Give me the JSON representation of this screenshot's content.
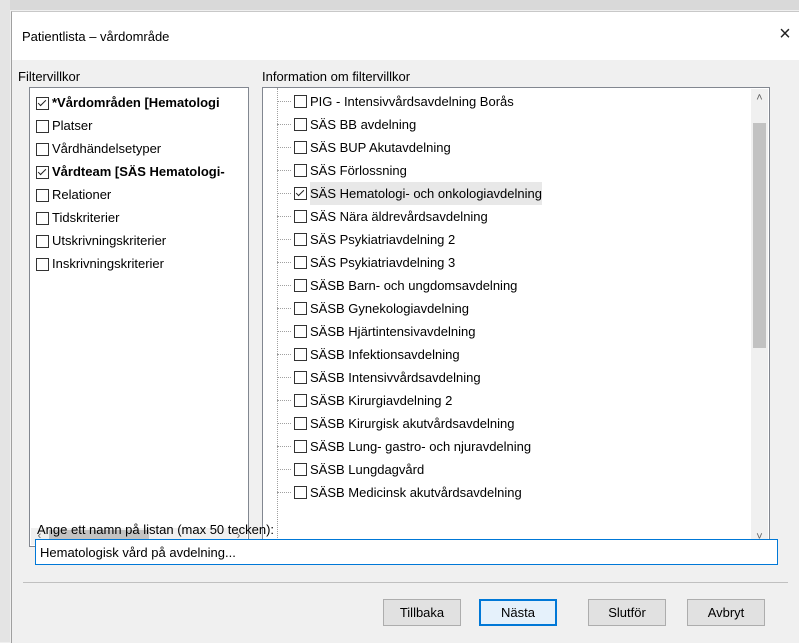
{
  "dialog": {
    "title": "Patientlista – vårdområde",
    "close_label": "×"
  },
  "left_panel": {
    "label": "Filtervillkor",
    "items": [
      {
        "label": "*Vårdområden [Hematologi",
        "checked": true,
        "bold": true
      },
      {
        "label": "Platser",
        "checked": false,
        "bold": false
      },
      {
        "label": "Vårdhändelsetyper",
        "checked": false,
        "bold": false
      },
      {
        "label": "Vårdteam [SÄS Hematologi-",
        "checked": true,
        "bold": true
      },
      {
        "label": "Relationer",
        "checked": false,
        "bold": false
      },
      {
        "label": "Tidskriterier",
        "checked": false,
        "bold": false
      },
      {
        "label": "Utskrivningskriterier",
        "checked": false,
        "bold": false
      },
      {
        "label": "Inskrivningskriterier",
        "checked": false,
        "bold": false
      }
    ]
  },
  "right_panel": {
    "label": "Information om filtervillkor",
    "items": [
      {
        "label": "PIG - Intensivvårdsavdelning Borås",
        "checked": false
      },
      {
        "label": "SÄS BB avdelning",
        "checked": false
      },
      {
        "label": "SÄS BUP Akutavdelning",
        "checked": false
      },
      {
        "label": "SÄS Förlossning",
        "checked": false
      },
      {
        "label": "SÄS Hematologi- och onkologiavdelning",
        "checked": true
      },
      {
        "label": "SÄS Nära äldrevårdsavdelning",
        "checked": false
      },
      {
        "label": "SÄS Psykiatriavdelning 2",
        "checked": false
      },
      {
        "label": "SÄS Psykiatriavdelning 3",
        "checked": false
      },
      {
        "label": "SÄSB Barn- och ungdomsavdelning",
        "checked": false
      },
      {
        "label": "SÄSB Gynekologiavdelning",
        "checked": false
      },
      {
        "label": "SÄSB Hjärtintensivavdelning",
        "checked": false
      },
      {
        "label": "SÄSB Infektionsavdelning",
        "checked": false
      },
      {
        "label": "SÄSB Intensivvårdsavdelning",
        "checked": false
      },
      {
        "label": "SÄSB Kirurgiavdelning 2",
        "checked": false
      },
      {
        "label": "SÄSB Kirurgisk akutvårdsavdelning",
        "checked": false
      },
      {
        "label": "SÄSB Lung- gastro- och njuravdelning",
        "checked": false
      },
      {
        "label": "SÄSB Lungdagvård",
        "checked": false
      },
      {
        "label": "SÄSB Medicinsk akutvårdsavdelning",
        "checked": false
      }
    ]
  },
  "name_field": {
    "label": "Ange ett namn på listan (max 50 tecken):",
    "value": "Hematologisk vård på avdelning..."
  },
  "buttons": {
    "back": "Tillbaka",
    "next": "Nästa",
    "finish": "Slutför",
    "cancel": "Avbryt"
  },
  "icons": {
    "scroll_left": "‹",
    "scroll_right": "›",
    "scroll_up": "˄",
    "scroll_down": "˅"
  },
  "colors": {
    "accent": "#0078d7",
    "selected_row": "#e8e8e8"
  }
}
